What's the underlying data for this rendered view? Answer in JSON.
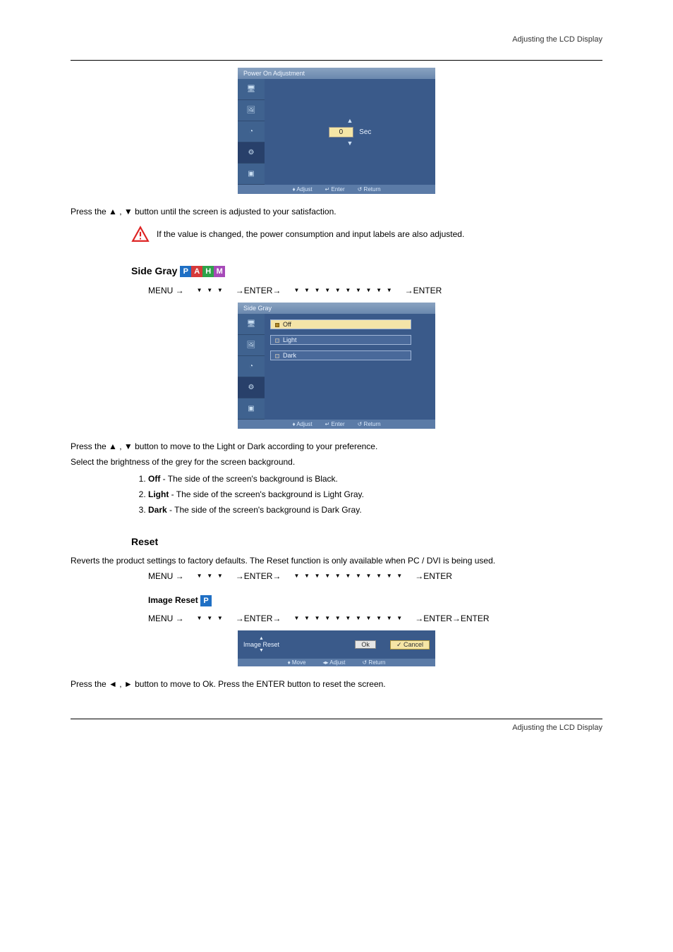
{
  "header": {
    "section": "Adjusting the LCD Display"
  },
  "footer": {
    "page_section": "Adjusting the LCD Display"
  },
  "osd1": {
    "title": "Power On Adjustment",
    "value": "0",
    "unit": "Sec",
    "footer": {
      "adjust": "Adjust",
      "enter": "Enter",
      "return": "Return"
    }
  },
  "note_arrow": "▲ , ▼",
  "power_on_step": "Press the ▲ , ▼ button until the screen is adjusted to your satisfaction.",
  "warning_text": "If the value is changed, the power consumption and input labels are also adjusted.",
  "side_gray": {
    "title": "Side Gray",
    "nav1_prefix": "MENU →",
    "nav1_mid": "→ENTER→",
    "nav1_tail": "→ENTER",
    "step_text": "Press the ▲ , ▼ button to move to the Light or Dark according to your preference.",
    "options": [
      "Off",
      "Light",
      "Dark"
    ],
    "footer": {
      "adjust": "Adjust",
      "enter": "Enter",
      "return": "Return"
    },
    "intro": "Select the brightness of the grey for the screen background.",
    "items": {
      "off": {
        "label": "Off",
        "desc": "The side of the screen's background is Black."
      },
      "light": {
        "label": "Light",
        "desc": "The side of the screen's background is Light Gray."
      },
      "dark": {
        "label": "Dark",
        "desc": "The side of the screen's background is Dark Gray."
      }
    }
  },
  "reset": {
    "title": "Reset",
    "intro": "Reverts the product settings to factory defaults. The Reset function is only available when PC / DVI is being used.",
    "nav_prefix": "MENU →",
    "nav_mid": "→ENTER→",
    "nav_tail": "→ENTER",
    "image_reset": {
      "title": "Image Reset",
      "nav_prefix": "MENU →",
      "nav_mid": "→ENTER→",
      "nav_tail": "→ENTER→ENTER",
      "osd_title": "Image Reset",
      "ok": "Ok",
      "cancel": "Cancel",
      "footer": {
        "move": "Move",
        "adjust": "Adjust",
        "return": "Return"
      },
      "step": "Press the ◄ , ► button to move to Ok. Press the ENTER button to reset the screen."
    }
  }
}
